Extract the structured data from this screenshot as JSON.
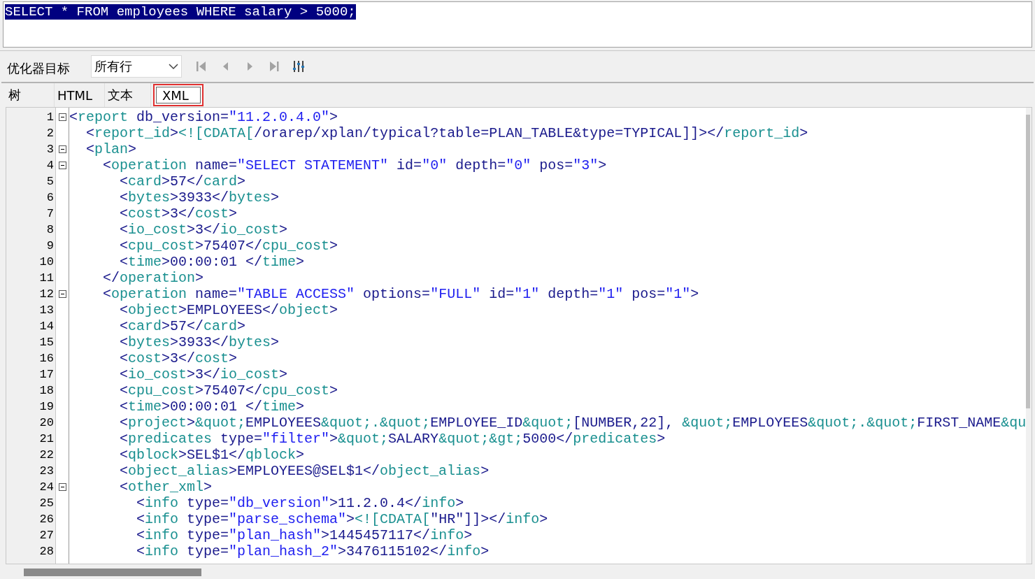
{
  "sql_editor": {
    "text": "SELECT * FROM employees WHERE salary > 5000;",
    "selected": true
  },
  "toolbar": {
    "label": "优化器目标",
    "dropdown": {
      "value": "所有行"
    },
    "nav_buttons": [
      {
        "kind": "first",
        "disabled": true
      },
      {
        "kind": "previous",
        "disabled": true
      },
      {
        "kind": "next",
        "disabled": true
      },
      {
        "kind": "last",
        "disabled": true
      },
      {
        "kind": "columns",
        "disabled": false
      }
    ]
  },
  "tabs": [
    {
      "label": "树",
      "selected": false
    },
    {
      "label": "HTML",
      "selected": false
    },
    {
      "label": "文本",
      "selected": false
    },
    {
      "label": "XML",
      "selected": true
    }
  ],
  "code_lines": [
    {
      "number": "1",
      "foldable": true,
      "segments": [
        {
          "kind": "plain",
          "text": "<"
        },
        {
          "kind": "tag",
          "text": "report"
        },
        {
          "kind": "plain",
          "text": " db_version="
        },
        {
          "kind": "value",
          "text": "\"11.2.0.4.0\""
        },
        {
          "kind": "plain",
          "text": ">"
        }
      ]
    },
    {
      "number": "2",
      "foldable": false,
      "segments": [
        {
          "kind": "plain",
          "text": "  <"
        },
        {
          "kind": "tag",
          "text": "report_id"
        },
        {
          "kind": "plain",
          "text": ">"
        },
        {
          "kind": "tag",
          "text": "<![CDATA["
        },
        {
          "kind": "plain",
          "text": "/orarep/xplan/typical?table=PLAN_TABLE&type=TYPICAL]]></"
        },
        {
          "kind": "tag",
          "text": "report_id"
        },
        {
          "kind": "plain",
          "text": ">"
        }
      ]
    },
    {
      "number": "3",
      "foldable": true,
      "segments": [
        {
          "kind": "plain",
          "text": "  <"
        },
        {
          "kind": "tag",
          "text": "plan"
        },
        {
          "kind": "plain",
          "text": ">"
        }
      ]
    },
    {
      "number": "4",
      "foldable": true,
      "segments": [
        {
          "kind": "plain",
          "text": "    <"
        },
        {
          "kind": "tag",
          "text": "operation"
        },
        {
          "kind": "plain",
          "text": " name="
        },
        {
          "kind": "value",
          "text": "\"SELECT STATEMENT\""
        },
        {
          "kind": "plain",
          "text": " id="
        },
        {
          "kind": "value",
          "text": "\"0\""
        },
        {
          "kind": "plain",
          "text": " depth="
        },
        {
          "kind": "value",
          "text": "\"0\""
        },
        {
          "kind": "plain",
          "text": " pos="
        },
        {
          "kind": "value",
          "text": "\"3\""
        },
        {
          "kind": "plain",
          "text": ">"
        }
      ]
    },
    {
      "number": "5",
      "foldable": false,
      "segments": [
        {
          "kind": "plain",
          "text": "      <"
        },
        {
          "kind": "tag",
          "text": "card"
        },
        {
          "kind": "plain",
          "text": ">57</"
        },
        {
          "kind": "tag",
          "text": "card"
        },
        {
          "kind": "plain",
          "text": ">"
        }
      ]
    },
    {
      "number": "6",
      "foldable": false,
      "segments": [
        {
          "kind": "plain",
          "text": "      <"
        },
        {
          "kind": "tag",
          "text": "bytes"
        },
        {
          "kind": "plain",
          "text": ">3933</"
        },
        {
          "kind": "tag",
          "text": "bytes"
        },
        {
          "kind": "plain",
          "text": ">"
        }
      ]
    },
    {
      "number": "7",
      "foldable": false,
      "segments": [
        {
          "kind": "plain",
          "text": "      <"
        },
        {
          "kind": "tag",
          "text": "cost"
        },
        {
          "kind": "plain",
          "text": ">3</"
        },
        {
          "kind": "tag",
          "text": "cost"
        },
        {
          "kind": "plain",
          "text": ">"
        }
      ]
    },
    {
      "number": "8",
      "foldable": false,
      "segments": [
        {
          "kind": "plain",
          "text": "      <"
        },
        {
          "kind": "tag",
          "text": "io_cost"
        },
        {
          "kind": "plain",
          "text": ">3</"
        },
        {
          "kind": "tag",
          "text": "io_cost"
        },
        {
          "kind": "plain",
          "text": ">"
        }
      ]
    },
    {
      "number": "9",
      "foldable": false,
      "segments": [
        {
          "kind": "plain",
          "text": "      <"
        },
        {
          "kind": "tag",
          "text": "cpu_cost"
        },
        {
          "kind": "plain",
          "text": ">75407</"
        },
        {
          "kind": "tag",
          "text": "cpu_cost"
        },
        {
          "kind": "plain",
          "text": ">"
        }
      ]
    },
    {
      "number": "10",
      "foldable": false,
      "segments": [
        {
          "kind": "plain",
          "text": "      <"
        },
        {
          "kind": "tag",
          "text": "time"
        },
        {
          "kind": "plain",
          "text": ">00:00:01 </"
        },
        {
          "kind": "tag",
          "text": "time"
        },
        {
          "kind": "plain",
          "text": ">"
        }
      ]
    },
    {
      "number": "11",
      "foldable": false,
      "segments": [
        {
          "kind": "plain",
          "text": "    </"
        },
        {
          "kind": "tag",
          "text": "operation"
        },
        {
          "kind": "plain",
          "text": ">"
        }
      ]
    },
    {
      "number": "12",
      "foldable": true,
      "segments": [
        {
          "kind": "plain",
          "text": "    <"
        },
        {
          "kind": "tag",
          "text": "operation"
        },
        {
          "kind": "plain",
          "text": " name="
        },
        {
          "kind": "value",
          "text": "\"TABLE ACCESS\""
        },
        {
          "kind": "plain",
          "text": " options="
        },
        {
          "kind": "value",
          "text": "\"FULL\""
        },
        {
          "kind": "plain",
          "text": " id="
        },
        {
          "kind": "value",
          "text": "\"1\""
        },
        {
          "kind": "plain",
          "text": " depth="
        },
        {
          "kind": "value",
          "text": "\"1\""
        },
        {
          "kind": "plain",
          "text": " pos="
        },
        {
          "kind": "value",
          "text": "\"1\""
        },
        {
          "kind": "plain",
          "text": ">"
        }
      ]
    },
    {
      "number": "13",
      "foldable": false,
      "segments": [
        {
          "kind": "plain",
          "text": "      <"
        },
        {
          "kind": "tag",
          "text": "object"
        },
        {
          "kind": "plain",
          "text": ">EMPLOYEES</"
        },
        {
          "kind": "tag",
          "text": "object"
        },
        {
          "kind": "plain",
          "text": ">"
        }
      ]
    },
    {
      "number": "14",
      "foldable": false,
      "segments": [
        {
          "kind": "plain",
          "text": "      <"
        },
        {
          "kind": "tag",
          "text": "card"
        },
        {
          "kind": "plain",
          "text": ">57</"
        },
        {
          "kind": "tag",
          "text": "card"
        },
        {
          "kind": "plain",
          "text": ">"
        }
      ]
    },
    {
      "number": "15",
      "foldable": false,
      "segments": [
        {
          "kind": "plain",
          "text": "      <"
        },
        {
          "kind": "tag",
          "text": "bytes"
        },
        {
          "kind": "plain",
          "text": ">3933</"
        },
        {
          "kind": "tag",
          "text": "bytes"
        },
        {
          "kind": "plain",
          "text": ">"
        }
      ]
    },
    {
      "number": "16",
      "foldable": false,
      "segments": [
        {
          "kind": "plain",
          "text": "      <"
        },
        {
          "kind": "tag",
          "text": "cost"
        },
        {
          "kind": "plain",
          "text": ">3</"
        },
        {
          "kind": "tag",
          "text": "cost"
        },
        {
          "kind": "plain",
          "text": ">"
        }
      ]
    },
    {
      "number": "17",
      "foldable": false,
      "segments": [
        {
          "kind": "plain",
          "text": "      <"
        },
        {
          "kind": "tag",
          "text": "io_cost"
        },
        {
          "kind": "plain",
          "text": ">3</"
        },
        {
          "kind": "tag",
          "text": "io_cost"
        },
        {
          "kind": "plain",
          "text": ">"
        }
      ]
    },
    {
      "number": "18",
      "foldable": false,
      "segments": [
        {
          "kind": "plain",
          "text": "      <"
        },
        {
          "kind": "tag",
          "text": "cpu_cost"
        },
        {
          "kind": "plain",
          "text": ">75407</"
        },
        {
          "kind": "tag",
          "text": "cpu_cost"
        },
        {
          "kind": "plain",
          "text": ">"
        }
      ]
    },
    {
      "number": "19",
      "foldable": false,
      "segments": [
        {
          "kind": "plain",
          "text": "      <"
        },
        {
          "kind": "tag",
          "text": "time"
        },
        {
          "kind": "plain",
          "text": ">00:00:01 </"
        },
        {
          "kind": "tag",
          "text": "time"
        },
        {
          "kind": "plain",
          "text": ">"
        }
      ]
    },
    {
      "number": "20",
      "foldable": false,
      "segments": [
        {
          "kind": "plain",
          "text": "      <"
        },
        {
          "kind": "tag",
          "text": "project"
        },
        {
          "kind": "plain",
          "text": ">"
        },
        {
          "kind": "tag",
          "text": "&quot;"
        },
        {
          "kind": "plain",
          "text": "EMPLOYEES"
        },
        {
          "kind": "tag",
          "text": "&quot;.&quot;"
        },
        {
          "kind": "plain",
          "text": "EMPLOYEE_ID"
        },
        {
          "kind": "tag",
          "text": "&quot;"
        },
        {
          "kind": "plain",
          "text": "[NUMBER,22], "
        },
        {
          "kind": "tag",
          "text": "&quot;"
        },
        {
          "kind": "plain",
          "text": "EMPLOYEES"
        },
        {
          "kind": "tag",
          "text": "&quot;.&quot;"
        },
        {
          "kind": "plain",
          "text": "FIRST_NAME"
        },
        {
          "kind": "tag",
          "text": "&qu"
        }
      ]
    },
    {
      "number": "21",
      "foldable": false,
      "segments": [
        {
          "kind": "plain",
          "text": "      <"
        },
        {
          "kind": "tag",
          "text": "predicates"
        },
        {
          "kind": "plain",
          "text": " type="
        },
        {
          "kind": "value",
          "text": "\"filter\""
        },
        {
          "kind": "plain",
          "text": ">"
        },
        {
          "kind": "tag",
          "text": "&quot;"
        },
        {
          "kind": "plain",
          "text": "SALARY"
        },
        {
          "kind": "tag",
          "text": "&quot;&gt;"
        },
        {
          "kind": "plain",
          "text": "5000</"
        },
        {
          "kind": "tag",
          "text": "predicates"
        },
        {
          "kind": "plain",
          "text": ">"
        }
      ]
    },
    {
      "number": "22",
      "foldable": false,
      "segments": [
        {
          "kind": "plain",
          "text": "      <"
        },
        {
          "kind": "tag",
          "text": "qblock"
        },
        {
          "kind": "plain",
          "text": ">SEL$1</"
        },
        {
          "kind": "tag",
          "text": "qblock"
        },
        {
          "kind": "plain",
          "text": ">"
        }
      ]
    },
    {
      "number": "23",
      "foldable": false,
      "segments": [
        {
          "kind": "plain",
          "text": "      <"
        },
        {
          "kind": "tag",
          "text": "object_alias"
        },
        {
          "kind": "plain",
          "text": ">EMPLOYEES@SEL$1</"
        },
        {
          "kind": "tag",
          "text": "object_alias"
        },
        {
          "kind": "plain",
          "text": ">"
        }
      ]
    },
    {
      "number": "24",
      "foldable": true,
      "segments": [
        {
          "kind": "plain",
          "text": "      <"
        },
        {
          "kind": "tag",
          "text": "other_xml"
        },
        {
          "kind": "plain",
          "text": ">"
        }
      ]
    },
    {
      "number": "25",
      "foldable": false,
      "segments": [
        {
          "kind": "plain",
          "text": "        <"
        },
        {
          "kind": "tag",
          "text": "info"
        },
        {
          "kind": "plain",
          "text": " type="
        },
        {
          "kind": "value",
          "text": "\"db_version\""
        },
        {
          "kind": "plain",
          "text": ">11.2.0.4</"
        },
        {
          "kind": "tag",
          "text": "info"
        },
        {
          "kind": "plain",
          "text": ">"
        }
      ]
    },
    {
      "number": "26",
      "foldable": false,
      "segments": [
        {
          "kind": "plain",
          "text": "        <"
        },
        {
          "kind": "tag",
          "text": "info"
        },
        {
          "kind": "plain",
          "text": " type="
        },
        {
          "kind": "value",
          "text": "\"parse_schema\""
        },
        {
          "kind": "plain",
          "text": ">"
        },
        {
          "kind": "tag",
          "text": "<![CDATA["
        },
        {
          "kind": "plain",
          "text": "\"HR\"]]></"
        },
        {
          "kind": "tag",
          "text": "info"
        },
        {
          "kind": "plain",
          "text": ">"
        }
      ]
    },
    {
      "number": "27",
      "foldable": false,
      "segments": [
        {
          "kind": "plain",
          "text": "        <"
        },
        {
          "kind": "tag",
          "text": "info"
        },
        {
          "kind": "plain",
          "text": " type="
        },
        {
          "kind": "value",
          "text": "\"plan_hash\""
        },
        {
          "kind": "plain",
          "text": ">1445457117</"
        },
        {
          "kind": "tag",
          "text": "info"
        },
        {
          "kind": "plain",
          "text": ">"
        }
      ]
    },
    {
      "number": "28",
      "foldable": false,
      "segments": [
        {
          "kind": "plain",
          "text": "        <"
        },
        {
          "kind": "tag",
          "text": "info"
        },
        {
          "kind": "plain",
          "text": " type="
        },
        {
          "kind": "value",
          "text": "\"plan_hash_2\""
        },
        {
          "kind": "plain",
          "text": ">3476115102</"
        },
        {
          "kind": "tag",
          "text": "info"
        },
        {
          "kind": "plain",
          "text": ">"
        }
      ]
    }
  ]
}
